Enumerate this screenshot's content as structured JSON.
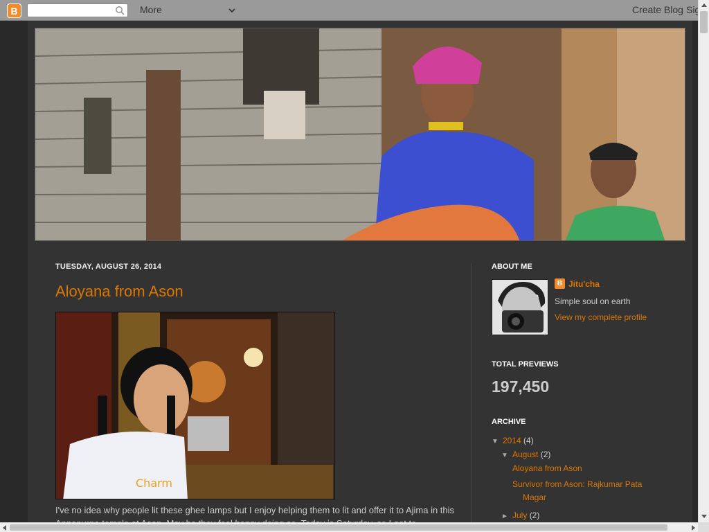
{
  "navbar": {
    "logo_letter": "B",
    "search_placeholder": "",
    "more_label": "More",
    "create_blog_label": "Create Blog",
    "sign_in_label": "Sign In"
  },
  "post": {
    "date": "TUESDAY, AUGUST 26, 2014",
    "title": "Aloyana from Ason",
    "image_shirt_text": "Charm",
    "body": "I've no idea why people lit these ghee lamps but I enjoy helping them to lit and offer it to Ajima in this Annapurna temple at Ason. May be they feel happy doing so. Today is Saturday, so I got to"
  },
  "sidebar": {
    "about": {
      "heading": "ABOUT ME",
      "name": "Jitu'cha",
      "description": "Simple soul on earth",
      "profile_link": "View my complete profile"
    },
    "stats": {
      "heading": "TOTAL PREVIEWS",
      "value": "197,450"
    },
    "archive": {
      "heading": "ARCHIVE",
      "year": {
        "toggle": "▼",
        "label": "2014",
        "count": "(4)"
      },
      "month": {
        "toggle": "▼",
        "label": "August",
        "count": "(2)"
      },
      "posts": [
        "Aloyana from Ason",
        "Survivor from Ason: Rajkumar Pata Magar"
      ],
      "next_month": {
        "toggle": "►",
        "label": "July",
        "count": "(2)"
      }
    }
  },
  "colors": {
    "accent": "#dd7700",
    "background": "#292929",
    "panel": "#333333",
    "navbar": "#9a9a9a"
  }
}
